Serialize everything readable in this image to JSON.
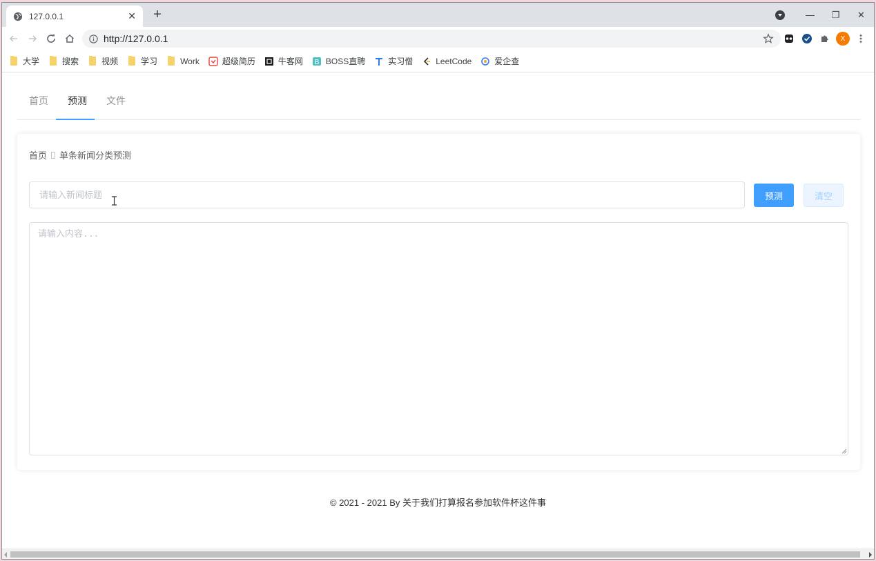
{
  "browser": {
    "tab_title": "127.0.0.1",
    "new_tab_symbol": "+",
    "url": "http://127.0.0.1",
    "window_controls": {
      "minimize": "—",
      "restore": "❐",
      "close": "✕"
    },
    "profile_initial": "X",
    "bookmarks": [
      {
        "label": "大学",
        "icon": "folder-icon"
      },
      {
        "label": "搜索",
        "icon": "folder-icon"
      },
      {
        "label": "视频",
        "icon": "folder-icon"
      },
      {
        "label": "学习",
        "icon": "folder-icon"
      },
      {
        "label": "Work",
        "icon": "folder-icon"
      },
      {
        "label": "超级简历",
        "icon": "resume-icon"
      },
      {
        "label": "牛客网",
        "icon": "nowcoder-icon"
      },
      {
        "label": "BOSS直聘",
        "icon": "boss-icon"
      },
      {
        "label": "实习僧",
        "icon": "shixiseng-icon"
      },
      {
        "label": "LeetCode",
        "icon": "leetcode-icon"
      },
      {
        "label": "爱企查",
        "icon": "aiqicha-icon"
      }
    ]
  },
  "nav": {
    "tabs": [
      {
        "label": "首页",
        "active": false
      },
      {
        "label": "预测",
        "active": true
      },
      {
        "label": "文件",
        "active": false
      }
    ]
  },
  "breadcrumb": {
    "home": "首页",
    "current": "单条新闻分类预测"
  },
  "form": {
    "title_placeholder": "请输入新闻标题",
    "title_value": "",
    "content_placeholder": "请输入内容...",
    "content_value": "",
    "predict_label": "预测",
    "clear_label": "清空"
  },
  "footer": {
    "text": "© 2021 - 2021 By 关于我们打算报名参加软件杯这件事"
  },
  "colors": {
    "primary": "#409eff",
    "clear_bg": "#ecf5ff",
    "clear_text": "#a0cfff"
  }
}
